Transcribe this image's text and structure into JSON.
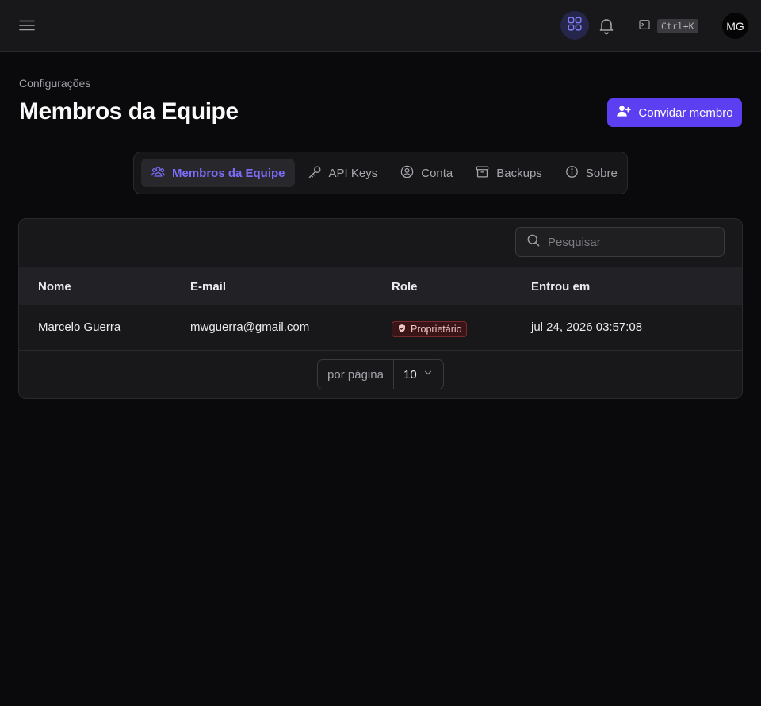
{
  "topbar": {
    "shortcut": "Ctrl+K",
    "avatar_initials": "MG"
  },
  "header": {
    "breadcrumb": "Configurações",
    "title": "Membros da Equipe",
    "invite_label": "Convidar membro"
  },
  "tabs": [
    {
      "label": "Membros da Equipe",
      "icon": "users-icon",
      "active": true
    },
    {
      "label": "API Keys",
      "icon": "key-icon",
      "active": false
    },
    {
      "label": "Conta",
      "icon": "user-circle-icon",
      "active": false
    },
    {
      "label": "Backups",
      "icon": "archive-icon",
      "active": false
    },
    {
      "label": "Sobre",
      "icon": "info-icon",
      "active": false
    }
  ],
  "search": {
    "placeholder": "Pesquisar",
    "value": ""
  },
  "table": {
    "columns": [
      "Nome",
      "E-mail",
      "Role",
      "Entrou em"
    ],
    "rows": [
      {
        "name": "Marcelo Guerra",
        "email": "mwguerra@gmail.com",
        "role": "Proprietário",
        "joined": "jul 24, 2026 03:57:08"
      }
    ]
  },
  "pagination": {
    "per_page_label": "por página",
    "per_page_value": "10"
  },
  "colors": {
    "accent": "#5b3ff0",
    "active_tab_text": "#7c6cf8",
    "owner_badge": "#3a1517",
    "background": "#0a0a0c"
  }
}
